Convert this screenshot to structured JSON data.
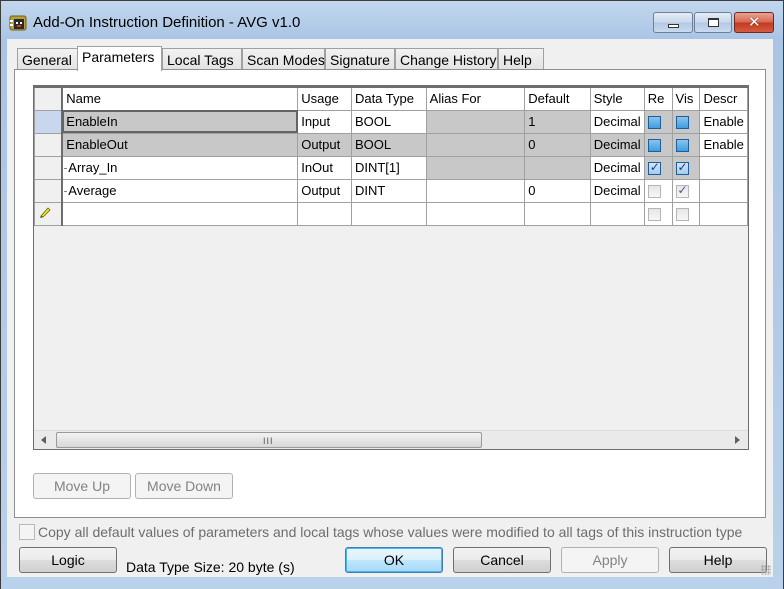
{
  "window": {
    "title": "Add-On Instruction Definition - AVG v1.0",
    "icon": "aoi-instruction-icon",
    "controls": {
      "minimize": "minimize-icon",
      "maximize": "maximize-icon",
      "close": "close-icon"
    }
  },
  "tabs": [
    {
      "label": "General",
      "active": false
    },
    {
      "label": "Parameters",
      "active": true
    },
    {
      "label": "Local Tags",
      "active": false
    },
    {
      "label": "Scan Modes",
      "active": false
    },
    {
      "label": "Signature",
      "active": false
    },
    {
      "label": "Change History",
      "active": false
    },
    {
      "label": "Help",
      "active": false
    }
  ],
  "grid": {
    "columns": [
      "Name",
      "Usage",
      "Data Type",
      "Alias For",
      "Default",
      "Style",
      "Re",
      "Vis",
      "Descr"
    ],
    "rows": [
      {
        "name": "EnableIn",
        "expandable": false,
        "usage": "Input",
        "data_type": "BOOL",
        "alias_for": "",
        "default": "1",
        "style": "Decimal",
        "req": false,
        "vis": false,
        "description": "Enable",
        "current": true
      },
      {
        "name": "EnableOut",
        "expandable": false,
        "usage": "Output",
        "data_type": "BOOL",
        "alias_for": "",
        "default": "0",
        "style": "Decimal",
        "req": false,
        "vis": false,
        "description": "Enable",
        "current": false
      },
      {
        "name": "Array_In",
        "expandable": true,
        "usage": "InOut",
        "data_type": "DINT[1]",
        "alias_for": "",
        "default": "",
        "style": "Decimal",
        "req": true,
        "vis": true,
        "description": "",
        "current": false
      },
      {
        "name": "Average",
        "expandable": true,
        "usage": "Output",
        "data_type": "DINT",
        "alias_for": "",
        "default": "0",
        "style": "Decimal",
        "req": false,
        "vis": true,
        "description": "",
        "current": false
      }
    ],
    "new_row_icon": "pencil-edit-icon",
    "scrollbar_grip": "III"
  },
  "buttons": {
    "move_up": "Move Up",
    "move_down": "Move Down",
    "logic": "Logic",
    "ok": "OK",
    "cancel": "Cancel",
    "apply": "Apply",
    "help": "Help"
  },
  "copy_defaults_label": "Copy all default values of parameters and local tags whose values were modified to all tags of this instruction type",
  "copy_defaults_checked": false,
  "data_type_size": "Data Type Size: 20 byte (s)"
}
